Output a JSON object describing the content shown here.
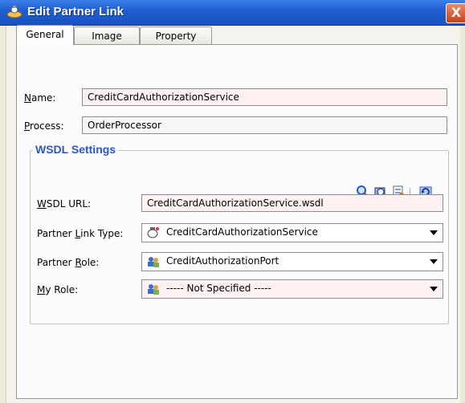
{
  "window": {
    "title": "Edit Partner Link",
    "close_label": "X"
  },
  "tabs": [
    {
      "label": "General",
      "active": true
    },
    {
      "label": "Image",
      "active": false
    },
    {
      "label": "Property",
      "active": false
    }
  ],
  "general": {
    "name": {
      "label": "Name:",
      "value": "CreditCardAuthorizationService"
    },
    "process": {
      "label": "Process:",
      "value": "OrderProcessor"
    }
  },
  "wsdl": {
    "group_title": "WSDL Settings",
    "tools": [
      "search-icon",
      "browse-icon",
      "create-icon",
      "refresh-icon"
    ],
    "url": {
      "label": "WSDL URL:",
      "value": "CreditCardAuthorizationService.wsdl"
    },
    "partner_link_type": {
      "label": "Partner Link Type:",
      "value": "CreditCardAuthorizationService"
    },
    "partner_role": {
      "label": "Partner Role:",
      "value": "CreditAuthorizationPort"
    },
    "my_role": {
      "label": "My Role:",
      "value": "----- Not Specified -----"
    }
  }
}
